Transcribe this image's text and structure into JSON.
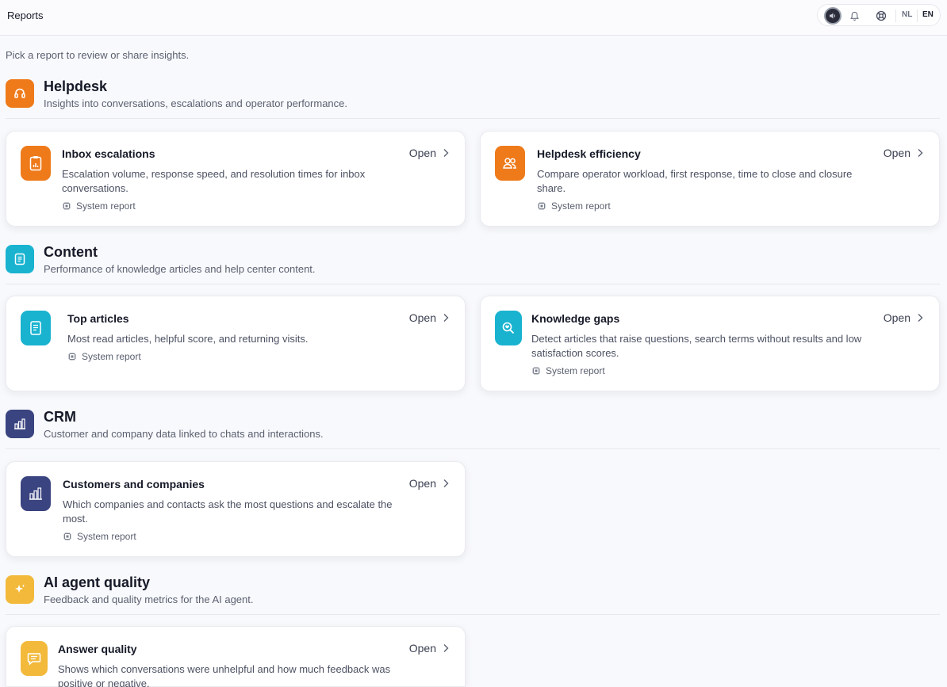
{
  "header": {
    "title": "Reports",
    "lang_nl": "NL",
    "lang_en": "EN"
  },
  "subtitle": "Pick a report to review or share insights.",
  "open_label": "Open",
  "system_report_label": "System report",
  "sections": [
    {
      "title": "Helpdesk",
      "description": "Insights into conversations, escalations and operator performance.",
      "color": "#ee7a1a",
      "cards": [
        {
          "title": "Inbox escalations",
          "description": "Escalation volume, response speed, and resolution times for inbox conversations."
        },
        {
          "title": "Helpdesk efficiency",
          "description": "Compare operator workload, first response, time to close and closure share."
        }
      ]
    },
    {
      "title": "Content",
      "description": "Performance of knowledge articles and help center content.",
      "color": "#19b3d0",
      "cards": [
        {
          "title": "Top articles",
          "description": "Most read articles, helpful score, and returning visits."
        },
        {
          "title": "Knowledge gaps",
          "description": "Detect articles that raise questions, search terms without results and low satisfaction scores."
        }
      ]
    },
    {
      "title": "CRM",
      "description": "Customer and company data linked to chats and interactions.",
      "color": "#3a4480",
      "cards": [
        {
          "title": "Customers and companies",
          "description": "Which companies and contacts ask the most questions and escalate the most."
        }
      ]
    },
    {
      "title": "AI agent quality",
      "description": "Feedback and quality metrics for the AI agent.",
      "color": "#f2b93b",
      "cards": [
        {
          "title": "Answer quality",
          "description": "Shows which conversations were unhelpful and how much feedback was positive or negative."
        }
      ]
    }
  ]
}
